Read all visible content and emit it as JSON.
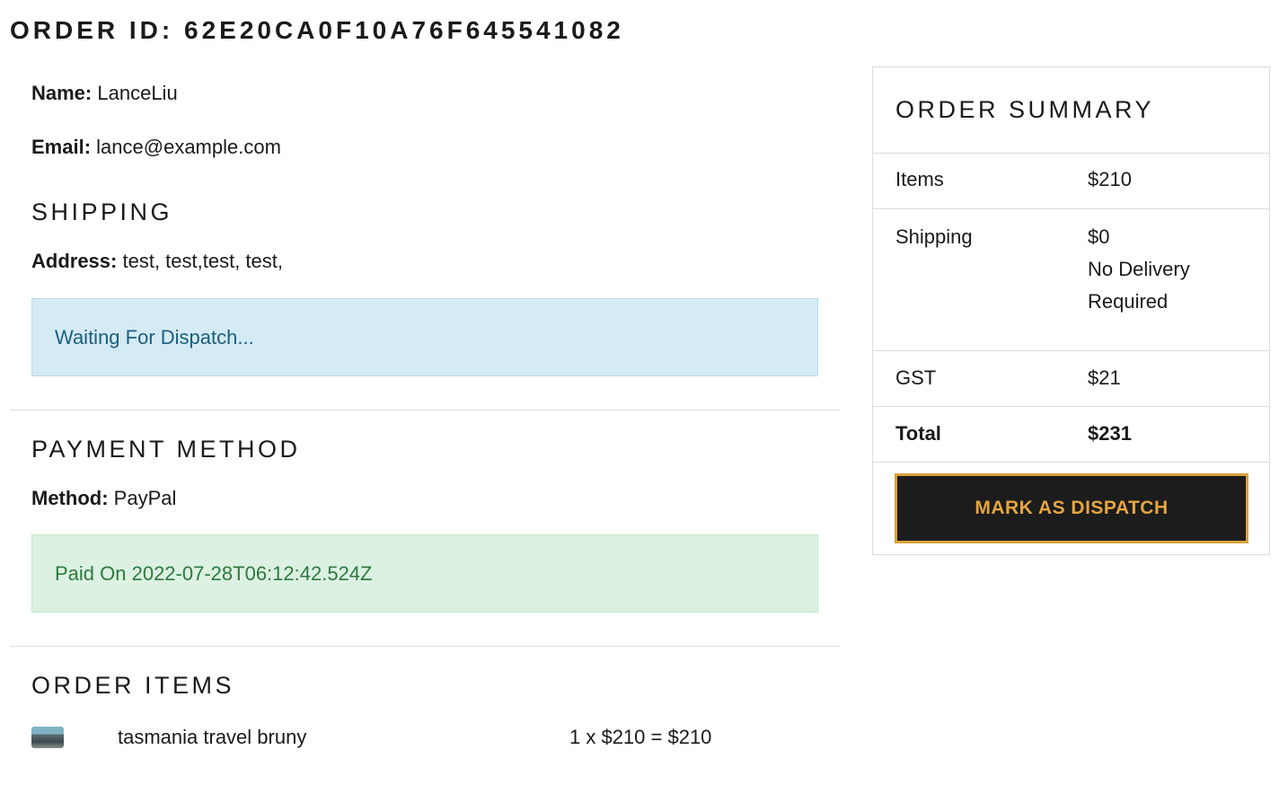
{
  "order": {
    "title": "ORDER ID: 62E20CA0F10A76F645541082"
  },
  "customer": {
    "name_label": "Name:",
    "name_value": "LanceLiu",
    "email_label": "Email:",
    "email_value": "lance@example.com"
  },
  "shipping": {
    "heading": "SHIPPING",
    "address_label": "Address:",
    "address_value": "test, test,test, test,",
    "status": "Waiting For Dispatch..."
  },
  "payment": {
    "heading": "PAYMENT METHOD",
    "method_label": "Method:",
    "method_value": "PayPal",
    "status": "Paid On 2022-07-28T06:12:42.524Z"
  },
  "order_items": {
    "heading": "ORDER ITEMS",
    "items": [
      {
        "name": "tasmania travel bruny",
        "price_line": "1 x $210 = $210",
        "thumbnail": "product-photo-thumbnail"
      }
    ]
  },
  "summary": {
    "heading": "ORDER SUMMARY",
    "items_label": "Items",
    "items_value": "$210",
    "shipping_label": "Shipping",
    "shipping_value": "$0",
    "shipping_note_line1": "No Delivery",
    "shipping_note_line2": "Required",
    "gst_label": "GST",
    "gst_value": "$21",
    "total_label": "Total",
    "total_value": "$231",
    "dispatch_button": "MARK AS DISPATCH"
  },
  "colors": {
    "info_bg": "#d4eaf5",
    "info_text": "#1b5e7d",
    "success_bg": "#dcf1e2",
    "success_text": "#2c7a3e",
    "button_bg": "#1c1c1c",
    "button_accent": "#e6a540"
  }
}
